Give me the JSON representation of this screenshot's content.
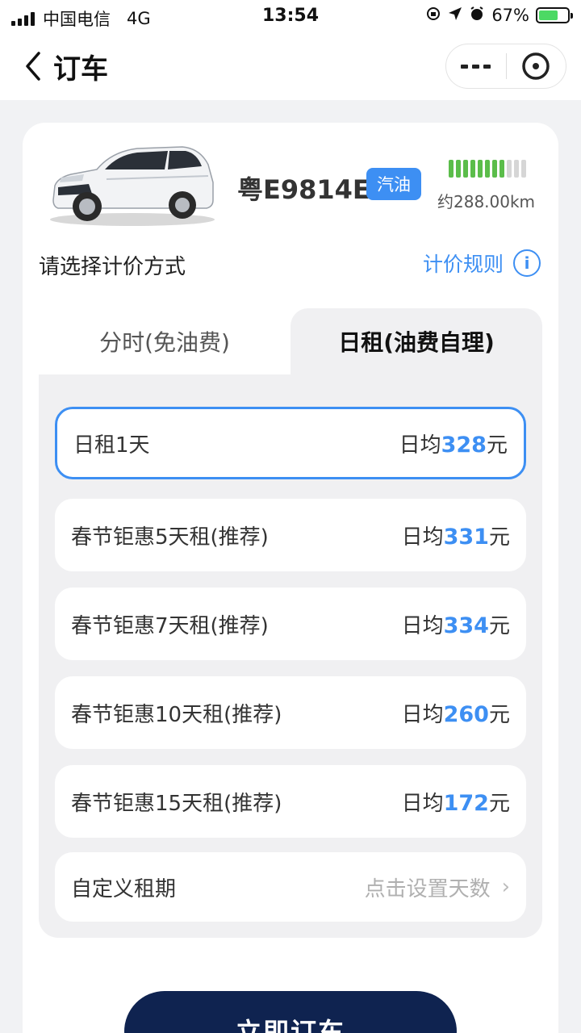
{
  "status_bar": {
    "carrier": "中国电信",
    "network": "4G",
    "time": "13:54",
    "battery_percent": "67%",
    "battery_level": 0.67
  },
  "nav": {
    "title": "订车"
  },
  "vehicle": {
    "plate": "粤E9814E",
    "fuel_type": "汽油",
    "range": "约288.00km",
    "range_bars_filled": 8,
    "range_bars_total": 11
  },
  "pricing": {
    "label": "请选择计价方式",
    "rules_link": "计价规则",
    "tabs": [
      {
        "label": "分时(免油费)",
        "active": false
      },
      {
        "label": "日租(油费自理)",
        "active": true
      }
    ],
    "price_prefix": "日均",
    "price_suffix": "元",
    "options": [
      {
        "name": "日租1天",
        "value": "328",
        "selected": true
      },
      {
        "name": "春节钜惠5天租(推荐)",
        "value": "331",
        "selected": false
      },
      {
        "name": "春节钜惠7天租(推荐)",
        "value": "334",
        "selected": false
      },
      {
        "name": "春节钜惠10天租(推荐)",
        "value": "260",
        "selected": false
      },
      {
        "name": "春节钜惠15天租(推荐)",
        "value": "172",
        "selected": false
      }
    ],
    "custom": {
      "name": "自定义租期",
      "hint": "点击设置天数"
    }
  },
  "actions": {
    "book_label": "立即订车"
  },
  "colors": {
    "accent": "#3d8ff3",
    "button_dark": "#0f2350",
    "range_bar_on": "#5bbd4a",
    "range_bar_off": "#d6d6d6"
  }
}
